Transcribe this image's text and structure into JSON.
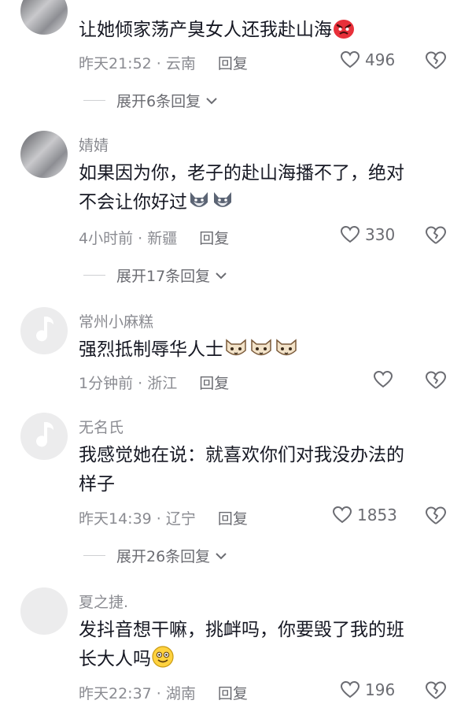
{
  "comments": [
    {
      "username": "",
      "text": "让她倾家荡产臭女人还我赴山海",
      "emoji": "angry-face",
      "time": "昨天21:52",
      "location": "云南",
      "reply_label": "回复",
      "likes": "496",
      "expand": "展开6条回复"
    },
    {
      "username": "婧婧",
      "text_line1": "如果因为你，老子的赴山海播不了，绝对",
      "text_line2": "不会让你好过",
      "emoji": "wolf-face",
      "time": "4小时前",
      "location": "新疆",
      "reply_label": "回复",
      "likes": "330",
      "expand": "展开17条回复"
    },
    {
      "username": "常州小麻糕",
      "text": "强烈抵制辱华人士",
      "emoji": "cat-face",
      "time": "1分钟前",
      "location": "浙江",
      "reply_label": "回复",
      "likes": ""
    },
    {
      "username": "无名氏",
      "text_line1": "我感觉她在说：就喜欢你们对我没办法的",
      "text_line2": "样子",
      "time": "昨天14:39",
      "location": "辽宁",
      "reply_label": "回复",
      "likes": "1853",
      "expand": "展开26条回复"
    },
    {
      "username": "夏之捷.",
      "text_line1": "发抖音想干嘛，挑衅吗，你要毁了我的班",
      "text_line2": "长大人吗",
      "emoji": "smile-face",
      "time": "昨天22:37",
      "location": "湖南",
      "reply_label": "回复",
      "likes": "196"
    }
  ],
  "separator": " · ",
  "colors": {
    "text": "#161823",
    "secondary": "#8a8b91",
    "background": "#ffffff"
  }
}
